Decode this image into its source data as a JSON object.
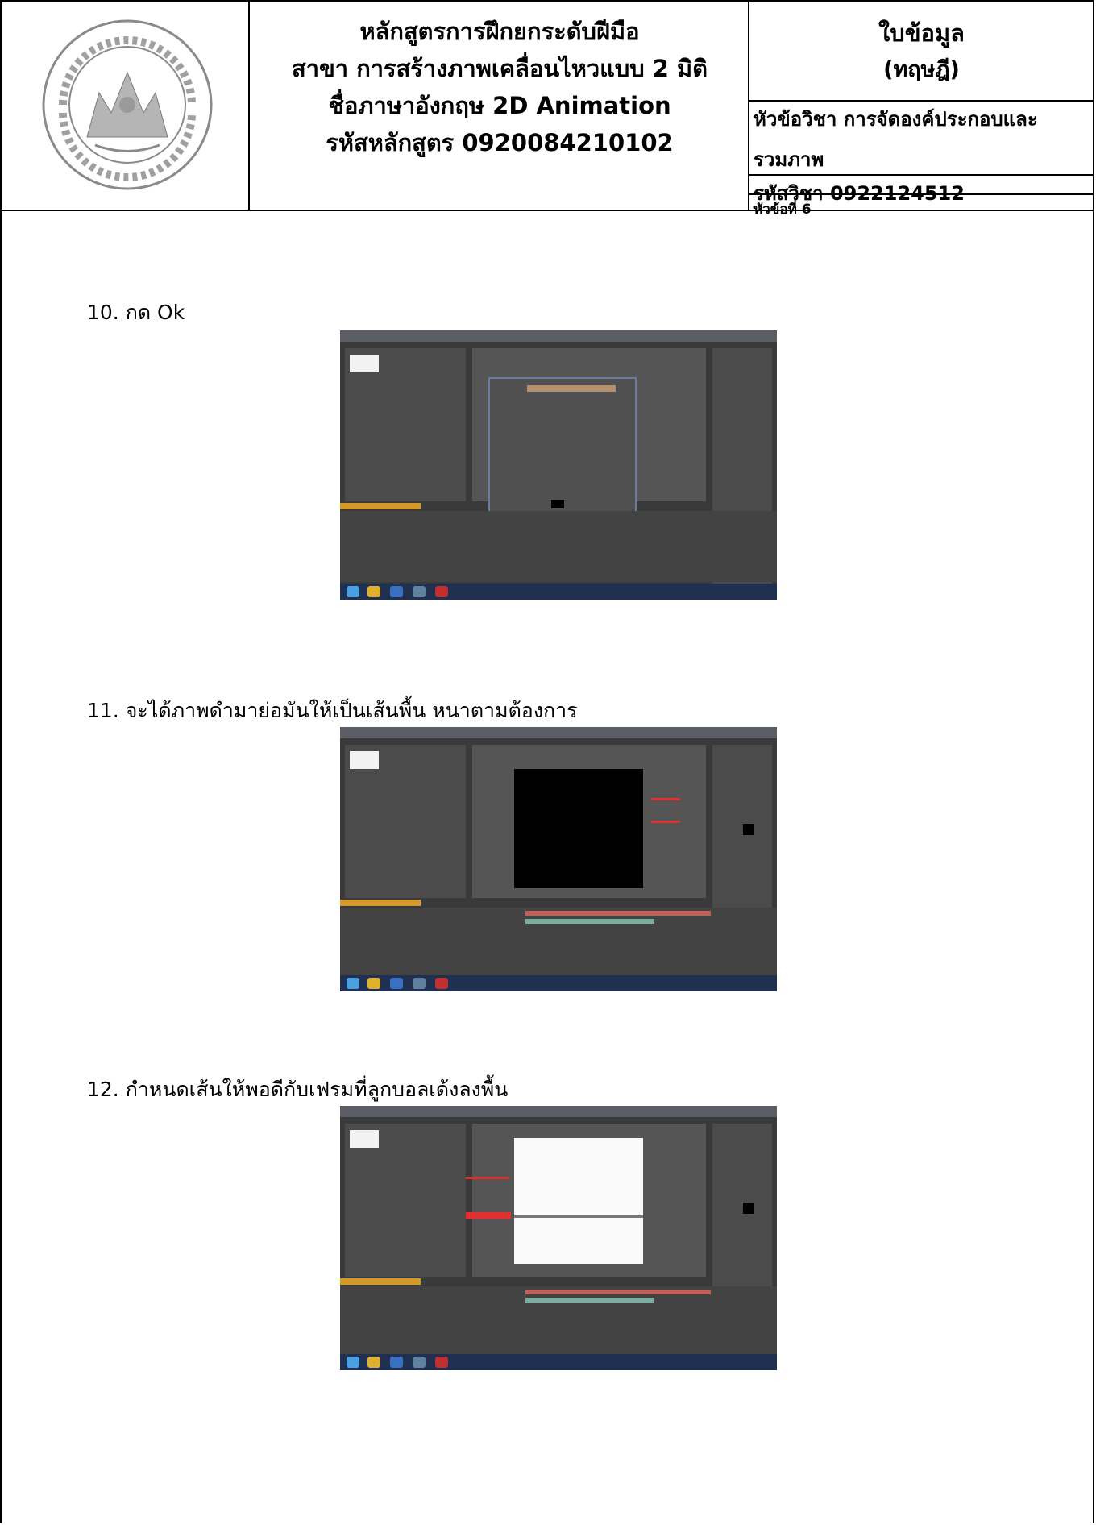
{
  "header": {
    "course_lines": [
      "หลักสูตรการฝึกยกระดับฝีมือ",
      "สาขา การสร้างภาพเคลื่อนไหวแบบ 2 มิติ",
      "ชื่อภาษาอังกฤษ 2D Animation",
      "รหัสหลักสูตร 0920084210102"
    ],
    "doc_type_line1": "ใบข้อมูล",
    "doc_type_line2": "(ทฤษฎี)",
    "subject_line1": "หัวข้อวิชา การจัดองค์ประกอบและ",
    "subject_line2": "รวมภาพ",
    "subject_code": "รหัสวิชา 0922124512",
    "topic_no": "หัวข้อที่ 6"
  },
  "steps": [
    {
      "label": "10. กด Ok",
      "image": "after-effects-dialog-screenshot"
    },
    {
      "label": "11. จะได้ภาพดำมาย่อมันให้เป็นเส้นพื้น หนาตามต้องการ",
      "image": "after-effects-black-solid-screenshot"
    },
    {
      "label": "12. กำหนดเส้นให้พอดีกับเฟรมที่ลูกบอลเด้งลงพื้น",
      "image": "after-effects-ground-line-screenshot"
    }
  ],
  "colors": {
    "ae_background": "#3a3a3a",
    "ae_panel": "#4b4b4b",
    "ae_timeline_bar": "#d39a2b",
    "annotation_red": "#e03030",
    "taskbar": "#1f3050"
  }
}
